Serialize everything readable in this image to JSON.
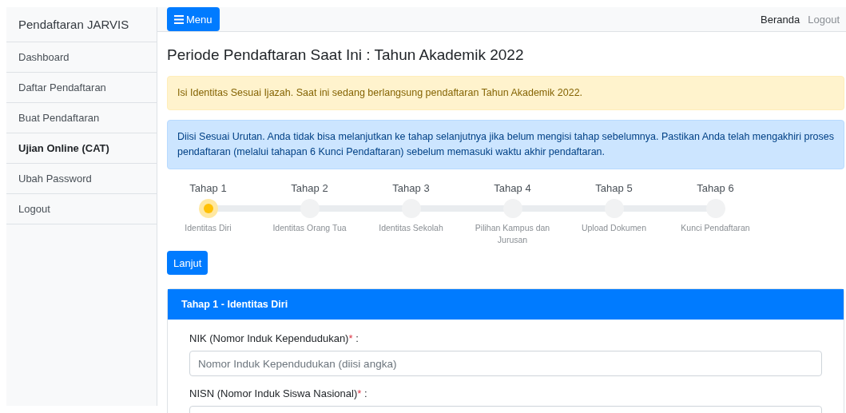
{
  "sidebar": {
    "title": "Pendaftaran JARVIS",
    "items": [
      {
        "label": "Dashboard",
        "selected": false
      },
      {
        "label": "Daftar Pendaftaran",
        "selected": false
      },
      {
        "label": "Buat Pendaftaran",
        "selected": false
      },
      {
        "label": "Ujian Online (CAT)",
        "selected": true
      },
      {
        "label": "Ubah Password",
        "selected": false
      },
      {
        "label": "Logout",
        "selected": false
      }
    ]
  },
  "topbar": {
    "menu_button": "Menu",
    "links": [
      {
        "label": "Beranda",
        "selected": true
      },
      {
        "label": "Logout",
        "selected": false
      }
    ]
  },
  "heading": "Periode Pendaftaran Saat Ini : Tahun Akademik 2022",
  "alerts": [
    {
      "kind": "warning",
      "text": "Isi Identitas Sesuai Ijazah. Saat ini sedang berlangsung pendaftaran Tahun Akademik 2022."
    },
    {
      "kind": "info",
      "text": "Diisi Sesuai Urutan. Anda tidak bisa melanjutkan ke tahap selanjutnya jika belum mengisi tahap sebelumnya. Pastikan Anda telah mengakhiri proses pendaftaran (melalui tahapan 6 Kunci Pendaftaran) sebelum memasuki waktu akhir pendaftaran."
    }
  ],
  "steps": [
    {
      "title": "Tahap 1",
      "caption": "Identitas Diri",
      "selected": true
    },
    {
      "title": "Tahap 2",
      "caption": "Identitas Orang Tua",
      "selected": false
    },
    {
      "title": "Tahap 3",
      "caption": "Identitas Sekolah",
      "selected": false
    },
    {
      "title": "Tahap 4",
      "caption": "Pilihan Kampus dan Jurusan",
      "selected": false
    },
    {
      "title": "Tahap 5",
      "caption": "Upload Dokumen",
      "selected": false
    },
    {
      "title": "Tahap 6",
      "caption": "Kunci Pendaftaran",
      "selected": false
    }
  ],
  "next_button": "Lanjut",
  "form_card": {
    "title": "Tahap 1 - Identitas Diri",
    "fields": [
      {
        "label": "NIK (Nomor Induk Kependudukan)",
        "required_mark": "*",
        "separator": ":",
        "placeholder": "Nomor Induk Kependudukan (diisi angka)"
      },
      {
        "label": "NISN (Nomor Induk Siswa Nasional)",
        "required_mark": "*",
        "separator": ":"
      }
    ]
  }
}
